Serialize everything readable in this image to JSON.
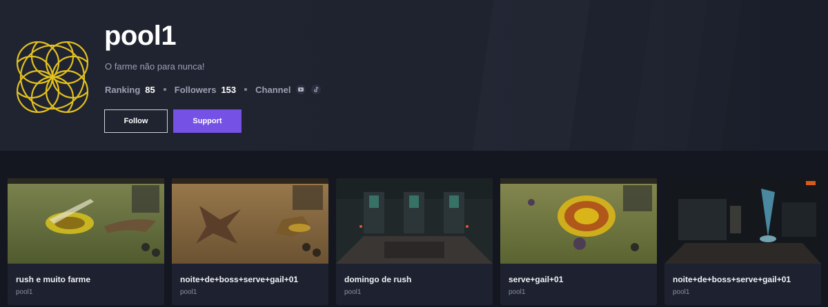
{
  "profile": {
    "username": "pool1",
    "bio": "O farme não para nunca!",
    "stats": {
      "ranking_label": "Ranking",
      "ranking_value": "85",
      "followers_label": "Followers",
      "followers_value": "153",
      "channel_label": "Channel"
    },
    "channels": [
      "youtube-icon",
      "tiktok-icon"
    ],
    "follow_label": "Follow",
    "support_label": "Support"
  },
  "colors": {
    "accent": "#7551e5",
    "avatar_gold": "#e3c11e",
    "background": "#141720",
    "header": "#202431"
  },
  "videos": [
    {
      "title": "rush e muito farme",
      "author": "pool1"
    },
    {
      "title": "noite+de+boss+serve+gail+01",
      "author": "pool1"
    },
    {
      "title": "domingo de rush",
      "author": "pool1"
    },
    {
      "title": "serve+gail+01",
      "author": "pool1"
    },
    {
      "title": "noite+de+boss+serve+gail+01",
      "author": "pool1"
    }
  ]
}
